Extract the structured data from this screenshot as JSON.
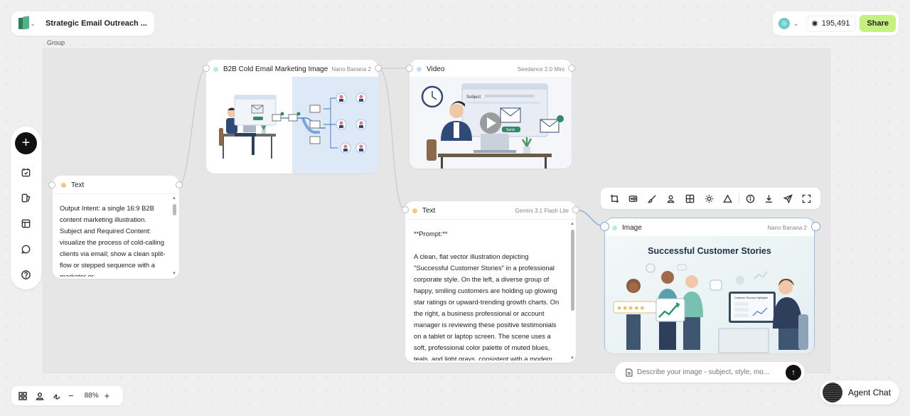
{
  "app": {
    "project_title": "Strategic Email Outreach ...",
    "group_label": "Group",
    "credits": "195,491",
    "share_label": "Share",
    "zoom": "88%",
    "agent_chat_label": "Agent Chat"
  },
  "nodes": {
    "text_left": {
      "title": "Text",
      "body": "Output Intent: a single 16:9 B2B content marketing illustration. Subject and Required Content: visualize the process of cold-calling clients via email; show a clean split-flow or stepped sequence with a marketer or"
    },
    "b2b_image": {
      "title": "B2B Cold Email Marketing Image",
      "model": "Nano Banana 2"
    },
    "video": {
      "title": "Video",
      "model": "Seedance 2.0 Mini",
      "thumb_subject": "Subject",
      "thumb_send": "Send"
    },
    "text_mid": {
      "title": "Text",
      "model": "Gemini 3.1 Flash Lite",
      "heading": "**Prompt:**",
      "body": "A clean, flat vector illustration depicting \"Successful Customer Stories\" in a professional corporate style. On the left, a diverse group of happy, smiling customers are holding up glowing star ratings or upward-trending growth charts. On the right, a business professional or account manager is reviewing these positive testimonials on a tablet or laptop screen. The scene uses a soft, professional color palette of muted blues, teals, and light grays, consistent with a modern"
    },
    "image": {
      "title": "Image",
      "model": "Nano Banana 2",
      "image_heading": "Successful Customer Stories",
      "screen_heading": "Customer Success Highlights"
    }
  },
  "prompt_bar": {
    "placeholder": "Describe your image - subject, style, mo..."
  },
  "icons": {
    "left_toolbar": [
      "add-icon",
      "calendar-icon",
      "assets-icon",
      "layout-icon",
      "chat-icon",
      "help-icon"
    ],
    "image_tools": [
      "crop-icon",
      "hd-icon",
      "brush-icon",
      "person-icon",
      "grid-icon",
      "light-icon",
      "triangle-icon",
      "info-icon",
      "download-icon",
      "send-icon",
      "expand-icon"
    ],
    "bottom_left": [
      "grid-icon",
      "person-icon",
      "sign-icon"
    ]
  },
  "colors": {
    "share_bg": "#c6f07f",
    "accent_blue": "#7aa6d9",
    "dot_text": "#f6c780",
    "dot_image": "#b8ece0",
    "dot_video": "#c9dcf8"
  }
}
